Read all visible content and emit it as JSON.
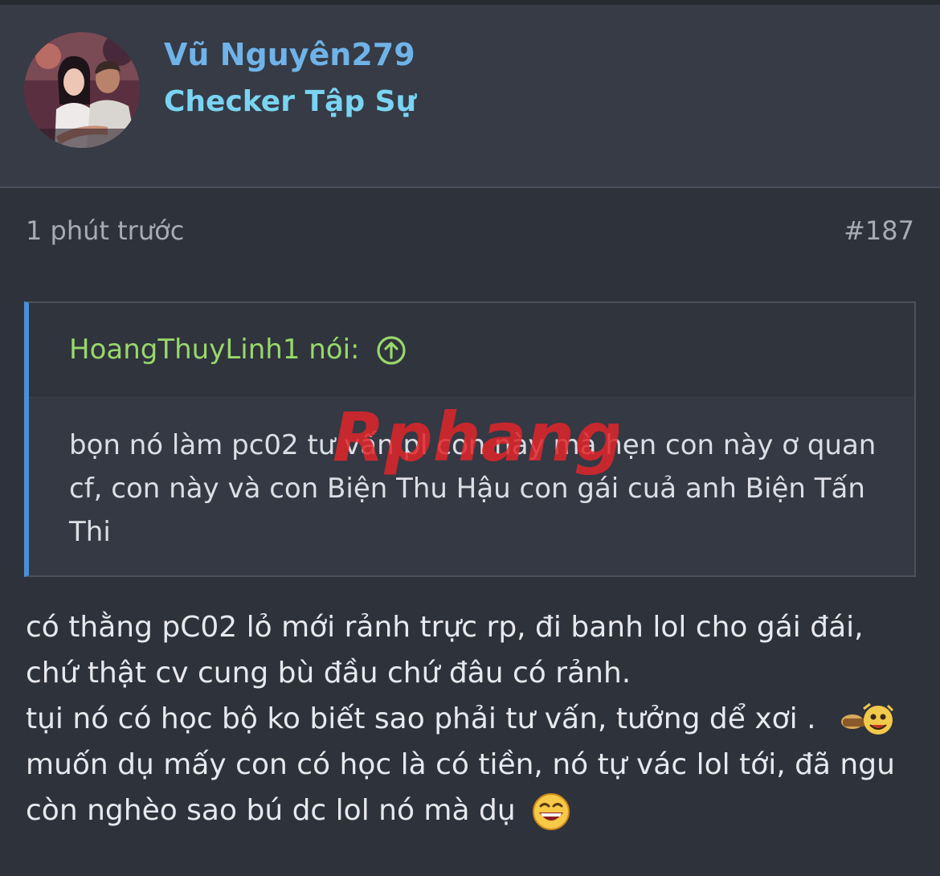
{
  "user": {
    "name": "Vũ Nguyên279",
    "title": "Checker Tập Sự"
  },
  "post": {
    "time": "1 phút trước",
    "number": "#187",
    "quote": {
      "author": "HoangThuyLinh1 nói:",
      "text": "bọn nó làm pc02 tư vấn pl con này mà hẹn con này ơ quan cf, con này và con Biện Thu Hậu con gái cuả anh Biện Tấn Thi"
    },
    "body": {
      "line1": "có thằng pC02 lỏ mới rảnh trực rp, đi banh lol cho gái đái,",
      "line2": "chứ thật cv cung bù đầu chứ đâu có rảnh.",
      "line3": "tụi nó có học bộ ko biết sao phải tư vấn, tưởng dể xơi .",
      "line4": "muốn dụ mấy con có học là có tiền, nó tự vác lol tới, đã ngu",
      "line5": "còn nghèo sao bú dc lol nó mà dụ"
    }
  },
  "watermark": "Rphang",
  "colors": {
    "background": "#2e323b",
    "username": "#6fb3e8",
    "user_title": "#79d4f2",
    "quote_author": "#98d86a",
    "quote_accent": "#4d8fd6"
  },
  "icons": {
    "quote_link": "arrow-up-circle-icon",
    "emoji_1": "dancing-emoji-icon",
    "emoji_2": "laughing-emoji-icon"
  }
}
